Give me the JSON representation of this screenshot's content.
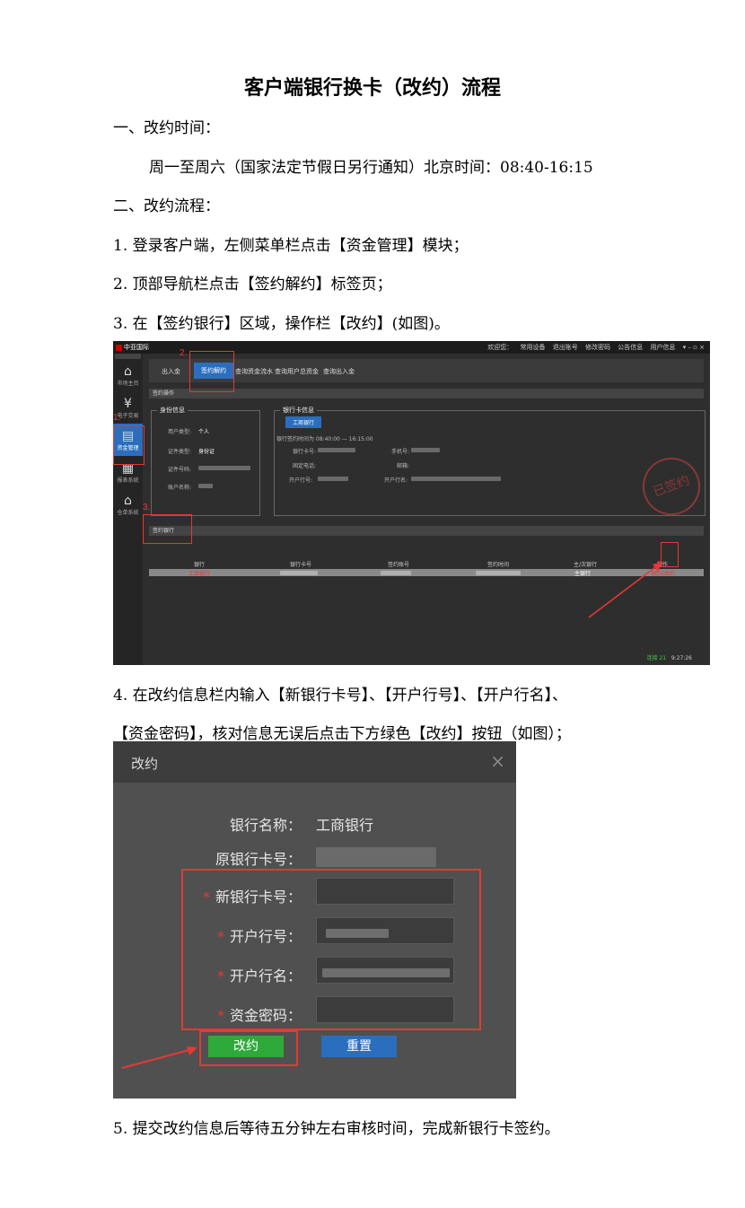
{
  "title": "客户端银行换卡（改约）流程",
  "sections": {
    "time_heading": "一、改约时间：",
    "time_detail": "周一至周六（国家法定节假日另行通知）北京时间：08:40-16:15",
    "flow_heading": "二、改约流程：",
    "step1": "1. 登录客户端，左侧菜单栏点击【资金管理】模块；",
    "step2": "2. 顶部导航栏点击【签约解约】标签页；",
    "step3": "3. 在【签约银行】区域，操作栏【改约】(如图)。",
    "step4_line1": "4. 在改约信息栏内输入【新银行卡号】、【开户行号】、【开户行名】、",
    "step4_line2": "【资金密码】，核对信息无误后点击下方绿色【改约】按钮（如图）；",
    "step5": "5. 提交改约信息后等待五分钟左右审核时间，完成新银行卡签约。"
  },
  "screenshot1": {
    "logo": "中亚国际",
    "top_links": [
      "欢迎您：",
      "常用设备",
      "退出账号",
      "修改密码",
      "公告信息",
      "用户信息"
    ],
    "side_items": [
      {
        "label": "市场主页",
        "icon": "home-icon",
        "glyph": "⌂"
      },
      {
        "label": "电子交易",
        "icon": "coin-icon",
        "glyph": "¥"
      },
      {
        "label": "资金管理",
        "icon": "fund-icon",
        "glyph": "▤"
      },
      {
        "label": "报表系统",
        "icon": "report-icon",
        "glyph": "▦"
      },
      {
        "label": "仓单系统",
        "icon": "warehouse-icon",
        "glyph": "⌂"
      }
    ],
    "tabs": [
      "出入金",
      "签约解约",
      "查询资金流水",
      "查询用户总资金",
      "查询出入金"
    ],
    "op_bar": "签约操作",
    "id_box": {
      "header": "身份信息",
      "user_type_label": "用户类型:",
      "user_type": "个人",
      "cert_type_label": "证件类型:",
      "cert_type": "身份证",
      "cert_no_label": "证件号码:",
      "account_name_label": "账户名称:"
    },
    "bank_box": {
      "header": "银行卡信息",
      "bank_button": "工商银行",
      "sign_time": "银行签约时间为 08:40:00 — 16:15:00",
      "card_no_label": "银行卡号:",
      "phone_label": "手机号:",
      "tel_label": "固定电话:",
      "email_label": "邮箱:",
      "branch_no_label": "开户行号:",
      "branch_name_label": "开户行名:"
    },
    "stamp_text": "已签约",
    "signed_bar": "签约银行",
    "table_headers": [
      "银行",
      "银行卡号",
      "签约账号",
      "签约时间",
      "主/次银行",
      "操作"
    ],
    "table_row": {
      "bank": "工商银行",
      "type": "主银行",
      "action": "解约/改约"
    },
    "status": {
      "conn": "连接 21",
      "time": "9:27:26"
    },
    "markers": [
      "1.",
      "2.",
      "3."
    ]
  },
  "screenshot2": {
    "title": "改约",
    "close": "×",
    "bank_name_label": "银行名称：",
    "bank_name": "工商银行",
    "old_card_label": "原银行卡号：",
    "new_card_label": "新银行卡号：",
    "branch_no_label": "开户行号：",
    "branch_name_label": "开户行名：",
    "fund_pwd_label": "资金密码：",
    "required_mark": "*",
    "submit_button": "改约",
    "reset_button": "重置"
  },
  "colors": {
    "annotation": "#e53935",
    "primary": "#2b6ebd",
    "submit": "#2eaa3a"
  }
}
